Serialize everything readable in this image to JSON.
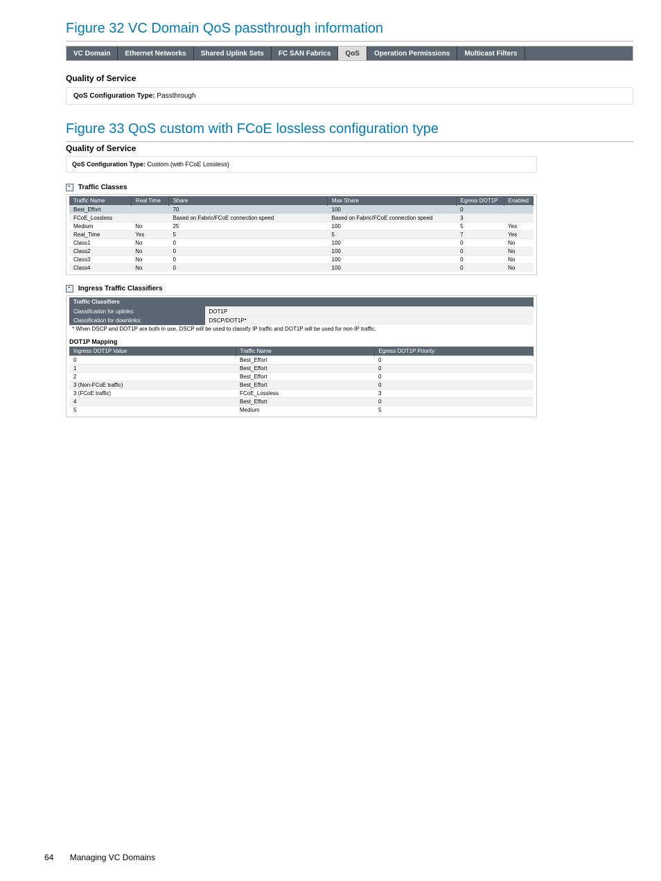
{
  "fig32": {
    "title": "Figure 32 VC Domain QoS passthrough information",
    "tabs": [
      "VC Domain",
      "Ethernet Networks",
      "Shared Uplink Sets",
      "FC SAN Fabrics",
      "QoS",
      "Operation Permissions",
      "Multicast Filters"
    ],
    "active_tab": "QoS",
    "panel_heading": "Quality of Service",
    "conf_label": "QoS Configuration Type:",
    "conf_value": "Passthrough"
  },
  "fig33": {
    "title": "Figure 33 QoS custom with FCoE lossless configuration type",
    "qos_heading": "Quality of Service",
    "conf_label": "QoS Configuration Type:",
    "conf_value": "Custom (with FCoE Lossless)",
    "traffic_classes_title": "Traffic Classes",
    "tc_cols": [
      "Traffic Name",
      "Real Time",
      "Share",
      "Max Share",
      "Egress DOT1P",
      "Enabled"
    ],
    "tc_rows": [
      {
        "name": "Best_Effort",
        "rt": "",
        "share": "70",
        "max": "100",
        "eg": "0",
        "en": ""
      },
      {
        "name": "FCoE_Lossless",
        "rt": "",
        "share": "Based on Fabric/FCoE connection speed",
        "max": "Based on Fabric/FCoE connection speed",
        "eg": "3",
        "en": ""
      },
      {
        "name": "Medium",
        "rt": "No",
        "share": "25",
        "max": "100",
        "eg": "5",
        "en": "Yes"
      },
      {
        "name": "Real_Time",
        "rt": "Yes",
        "share": "5",
        "max": "5",
        "eg": "7",
        "en": "Yes"
      },
      {
        "name": "Class1",
        "rt": "No",
        "share": "0",
        "max": "100",
        "eg": "0",
        "en": "No"
      },
      {
        "name": "Class2",
        "rt": "No",
        "share": "0",
        "max": "100",
        "eg": "0",
        "en": "No"
      },
      {
        "name": "Class3",
        "rt": "No",
        "share": "0",
        "max": "100",
        "eg": "0",
        "en": "No"
      },
      {
        "name": "Class4",
        "rt": "No",
        "share": "0",
        "max": "100",
        "eg": "0",
        "en": "No"
      }
    ],
    "ingress_title": "Ingress Traffic Classifiers",
    "cls_header": "Traffic Classifiers",
    "cls_rows": [
      {
        "k": "Classification for uplinks:",
        "v": "DOT1P"
      },
      {
        "k": "Classification for downlinks:",
        "v": "DSCP/DOT1P*"
      }
    ],
    "cls_footnote": "* When DSCP and DOT1P are both in use, DSCP will be used to classify IP traffic and DOT1P will be used for non-IP traffic.",
    "map_title": "DOT1P Mapping",
    "map_cols": [
      "Ingress DOT1P Value",
      "Traffic Name",
      "Egress DOT1P Priority"
    ],
    "map_rows": [
      {
        "v": "0",
        "tn": "Best_Effort",
        "p": "0"
      },
      {
        "v": "1",
        "tn": "Best_Effort",
        "p": "0"
      },
      {
        "v": "2",
        "tn": "Best_Effort",
        "p": "0"
      },
      {
        "v": "3 (Non-FCoE traffic)",
        "tn": "Best_Effort",
        "p": "0"
      },
      {
        "v": "3 (FCoE traffic)",
        "tn": "FCoE_Lossless",
        "p": "3"
      },
      {
        "v": "4",
        "tn": "Best_Effort",
        "p": "0"
      },
      {
        "v": "5",
        "tn": "Medium",
        "p": "5"
      }
    ]
  },
  "footer": {
    "page": "64",
    "section": "Managing VC Domains"
  }
}
